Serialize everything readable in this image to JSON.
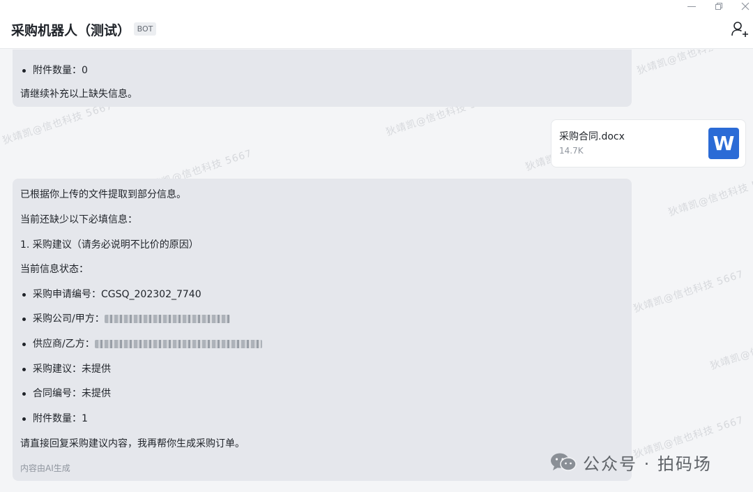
{
  "header": {
    "title": "采购机器人（测试）",
    "badge": "BOT"
  },
  "watermark": {
    "text": "狄靖凯@信也科技 5667"
  },
  "messages": {
    "top": {
      "attachment_line": "附件数量：0",
      "footer_line": "请继续补充以上缺失信息。"
    },
    "file": {
      "name": "采购合同.docx",
      "size": "14.7K",
      "icon_letter": "W"
    },
    "main": {
      "intro": "已根据你上传的文件提取到部分信息。",
      "missing_title": "当前还缺少以下必填信息：",
      "missing_item": "1. 采购建议（请务必说明不比价的原因）",
      "status_title": "当前信息状态：",
      "items": [
        "采购申请编号：CGSQ_202302_7740",
        "采购公司/甲方：",
        "供应商/乙方：",
        "采购建议：未提供",
        "合同编号：未提供",
        "附件数量：1"
      ],
      "closing": "请直接回复采购建议内容，我再帮你生成采购订单。",
      "ai_note": "内容由AI生成"
    }
  },
  "footer_brand": {
    "text": "公众号 · 拍码场"
  },
  "colors": {
    "bubble": "#e5e7ec",
    "word_blue": "#2b6bd6",
    "background": "#f4f5f7"
  }
}
